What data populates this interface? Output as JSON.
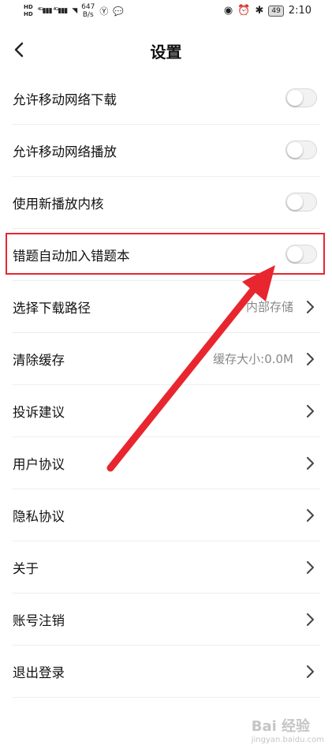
{
  "status_bar": {
    "network_speed_value": "647",
    "network_speed_unit": "B/s",
    "battery": "49",
    "time": "2:10"
  },
  "header": {
    "title": "设置"
  },
  "settings": [
    {
      "label": "允许移动网络下载",
      "type": "toggle",
      "on": false
    },
    {
      "label": "允许移动网络播放",
      "type": "toggle",
      "on": false
    },
    {
      "label": "使用新播放内核",
      "type": "toggle",
      "on": false
    },
    {
      "label": "错题自动加入错题本",
      "type": "toggle",
      "on": false
    },
    {
      "label": "选择下载路径",
      "type": "link",
      "value": "内部存储"
    },
    {
      "label": "清除缓存",
      "type": "link",
      "value": "缓存大小:0.0M"
    },
    {
      "label": "投诉建议",
      "type": "link",
      "value": ""
    },
    {
      "label": "用户协议",
      "type": "link",
      "value": ""
    },
    {
      "label": "隐私协议",
      "type": "link",
      "value": ""
    },
    {
      "label": "关于",
      "type": "link",
      "value": ""
    },
    {
      "label": "账号注销",
      "type": "link",
      "value": ""
    },
    {
      "label": "退出登录",
      "type": "link",
      "value": ""
    }
  ],
  "annotation": {
    "highlight_color": "#e8262f",
    "arrow_color": "#e8262f"
  },
  "watermark": {
    "brand": "Bai 经验",
    "domain": "jingyan.baidu.com"
  }
}
